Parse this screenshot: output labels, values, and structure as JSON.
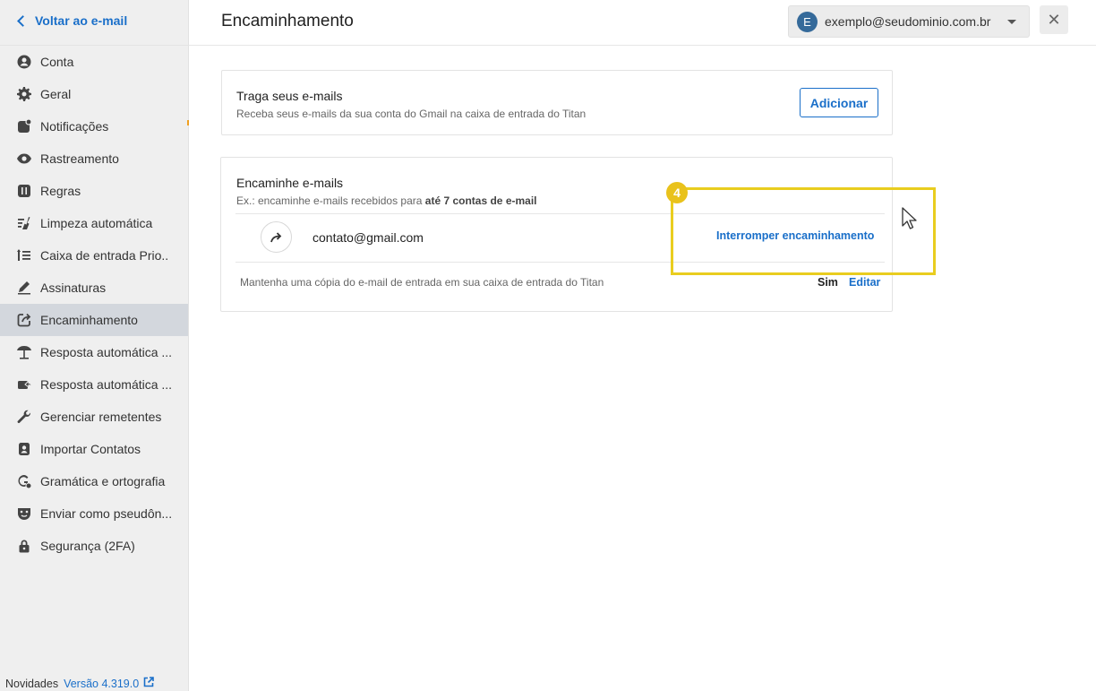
{
  "sidebar": {
    "back_label": "Voltar ao e-mail",
    "items": [
      {
        "label": "Conta",
        "icon": "person-icon"
      },
      {
        "label": "Geral",
        "icon": "gear-icon"
      },
      {
        "label": "Notificações",
        "icon": "bell-icon"
      },
      {
        "label": "Rastreamento",
        "icon": "eye-icon"
      },
      {
        "label": "Regras",
        "icon": "rules-icon"
      },
      {
        "label": "Limpeza automática",
        "icon": "broom-icon"
      },
      {
        "label": "Caixa de entrada Prio..",
        "icon": "priority-icon"
      },
      {
        "label": "Assinaturas",
        "icon": "pen-icon"
      },
      {
        "label": "Encaminhamento",
        "icon": "forward-icon",
        "active": true
      },
      {
        "label": "Resposta automática ...",
        "icon": "umbrella-icon"
      },
      {
        "label": "Resposta automática ...",
        "icon": "auto-reply-icon"
      },
      {
        "label": "Gerenciar remetentes",
        "icon": "wrench-icon"
      },
      {
        "label": "Importar Contatos",
        "icon": "contacts-icon"
      },
      {
        "label": "Gramática e ortografia",
        "icon": "grammar-icon"
      },
      {
        "label": "Enviar como pseudôn...",
        "icon": "mask-icon"
      },
      {
        "label": "Segurança (2FA)",
        "icon": "lock-icon"
      }
    ],
    "footer": {
      "news_label": "Novidades",
      "version_label": "Versão 4.319.0"
    }
  },
  "header": {
    "title": "Encaminhamento",
    "account": {
      "avatar_letter": "E",
      "email": "exemplo@seudominio.com.br"
    },
    "close_label": "✕"
  },
  "import_card": {
    "title": "Traga seus e-mails",
    "subtitle": "Receba seus e-mails da sua conta do Gmail na caixa de entrada do Titan",
    "button_label": "Adicionar"
  },
  "forward_card": {
    "title": "Encaminhe e-mails",
    "subtitle_prefix": "Ex.: encaminhe e-mails recebidos para ",
    "subtitle_bold": "até 7 contas de e-mail",
    "forward_email": "contato@gmail.com",
    "stop_label": "Interromper encaminhamento",
    "keep_copy_label": "Mantenha uma cópia do e-mail de entrada em sua caixa de entrada do Titan",
    "keep_copy_value": "Sim",
    "edit_label": "Editar"
  },
  "annotation": {
    "step_number": "4",
    "color": "#e9cd1f"
  },
  "colors": {
    "accent": "#1a6fc9",
    "active_bg": "#d3d7dd",
    "sidebar_bg": "#efefef"
  }
}
